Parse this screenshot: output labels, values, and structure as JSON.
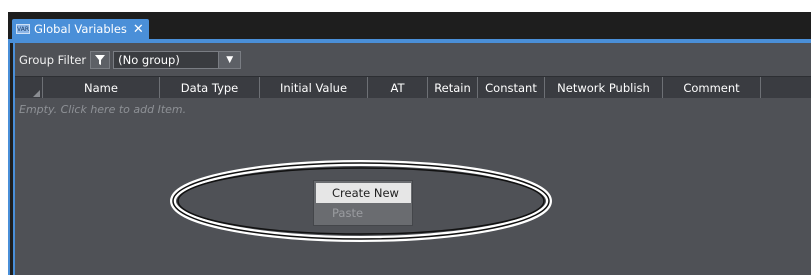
{
  "tab": {
    "icon": "global-variables-icon",
    "icon_text": "VAR",
    "label": "Global Variables",
    "close": "✕"
  },
  "filter": {
    "label": "Group Filter",
    "value": "(No group)",
    "funnel_icon": "funnel-icon",
    "dropdown_icon": "chevron-down-icon"
  },
  "columns": [
    {
      "label": "Name"
    },
    {
      "label": "Data Type"
    },
    {
      "label": "Initial Value"
    },
    {
      "label": "AT"
    },
    {
      "label": "Retain"
    },
    {
      "label": "Constant"
    },
    {
      "label": "Network Publish"
    },
    {
      "label": "Comment"
    }
  ],
  "grid": {
    "empty_text": "Empty. Click here to add Item."
  },
  "context_menu": {
    "create_new": "Create New",
    "paste": "Paste"
  },
  "colors": {
    "accent": "#4a8fd8",
    "panel": "#4f5156",
    "header": "#3a3c41"
  }
}
